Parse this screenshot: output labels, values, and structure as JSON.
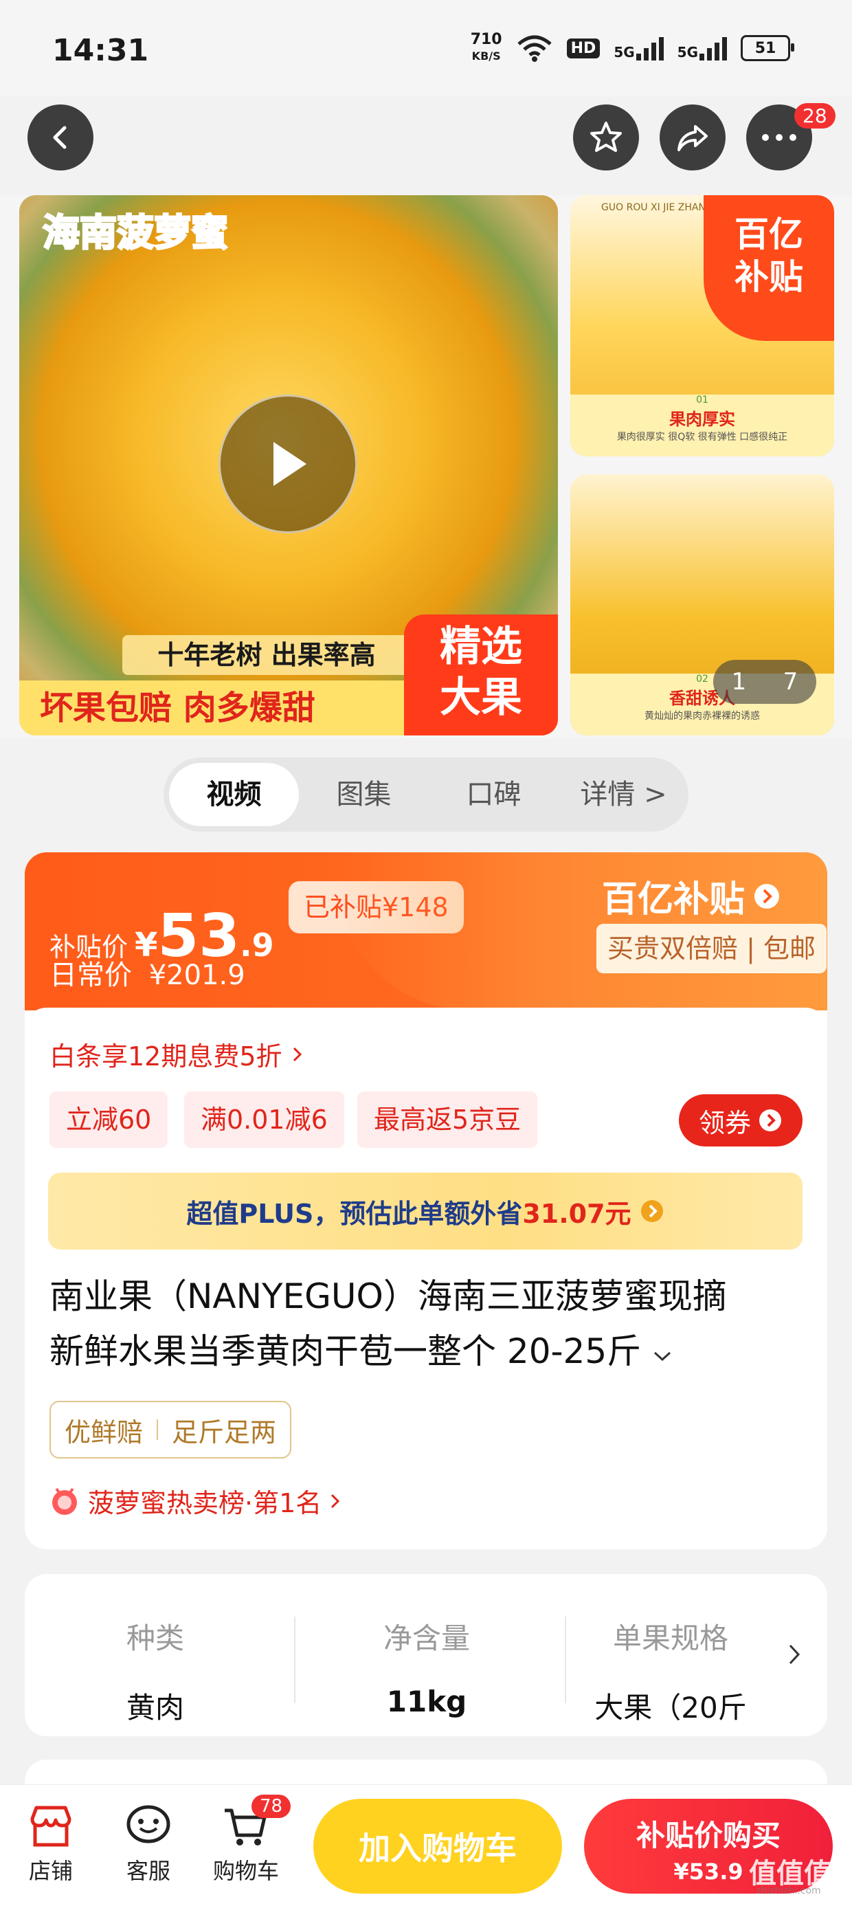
{
  "status_bar": {
    "time": "14:31",
    "net_speed_value": "710",
    "net_speed_unit": "KB/S",
    "hd_label": "HD",
    "signal1_label": "5G",
    "signal2_label": "5G",
    "battery": "51"
  },
  "top_nav": {
    "more_badge": "28"
  },
  "gallery": {
    "main_title": "海南菠萝蜜",
    "main_tag1": "十年老树 出果率高",
    "main_tag2": "坏果包赔 肉多爆甜",
    "main_tag3_line1": "精选",
    "main_tag3_line2": "大果",
    "side1_header": "GUO ROU XI JIE ZHAN SHI",
    "side1_badge_line1": "百亿",
    "side1_badge_line2": "补贴",
    "side1_num": "01",
    "side1_caption": "果肉厚实",
    "side1_sub": "果肉很厚实 很Q软 很有弹性 口感很纯正",
    "side2_num": "02",
    "side2_caption": "香甜诱人",
    "side2_sub": "黄灿灿的果肉赤裸裸的诱惑",
    "page_current": "1",
    "page_total": "7"
  },
  "tabs": [
    {
      "label": "视频",
      "active": true
    },
    {
      "label": "图集",
      "active": false
    },
    {
      "label": "口碑",
      "active": false
    },
    {
      "label": "详情 >",
      "active": false
    }
  ],
  "price": {
    "subsidy_label": "补贴价",
    "currency": "¥",
    "price_int": "53",
    "price_dec": ".9",
    "subsidized_tag": "已补贴¥148",
    "daily_label": "日常价",
    "daily_price": "¥201.9",
    "brand": "百亿补贴",
    "brand_sub": "买贵双倍赔 | 包邮"
  },
  "promos": {
    "baitiao": "白条享12期息费5折",
    "chips": [
      "立减60",
      "满0.01减6",
      "最高返5京豆"
    ],
    "coupon_button": "领券",
    "plus_prefix": "超值PLUS，预估此单额外省",
    "plus_amount": "31.07元"
  },
  "product": {
    "title_line1": "南业果（NANYEGUO）海南三亚菠萝蜜现摘",
    "title_line2": "新鲜水果当季黄肉干苞一整个 20-25斤",
    "service_tags": [
      "优鲜赔",
      "足斤足两"
    ],
    "ranking": "菠萝蜜热卖榜·第1名"
  },
  "specs": [
    {
      "label": "种类",
      "value": "黄肉"
    },
    {
      "label": "净含量",
      "value": "11kg"
    },
    {
      "label": "单果规格",
      "value": "大果（20斤"
    }
  ],
  "bottom_bar": {
    "shop": "店铺",
    "service": "客服",
    "cart": "购物车",
    "cart_badge": "78",
    "add_to_cart": "加入购物车",
    "buy_label": "补贴价购买",
    "buy_price": "¥53.9",
    "watermark": "值值值",
    "watermark_url": "zhizhizhi.com"
  },
  "colors": {
    "accent_orange": "#ff5b1a",
    "accent_red": "#e0251b",
    "cart_yellow": "#ffd21f",
    "brand_gold": "#c8932f"
  }
}
